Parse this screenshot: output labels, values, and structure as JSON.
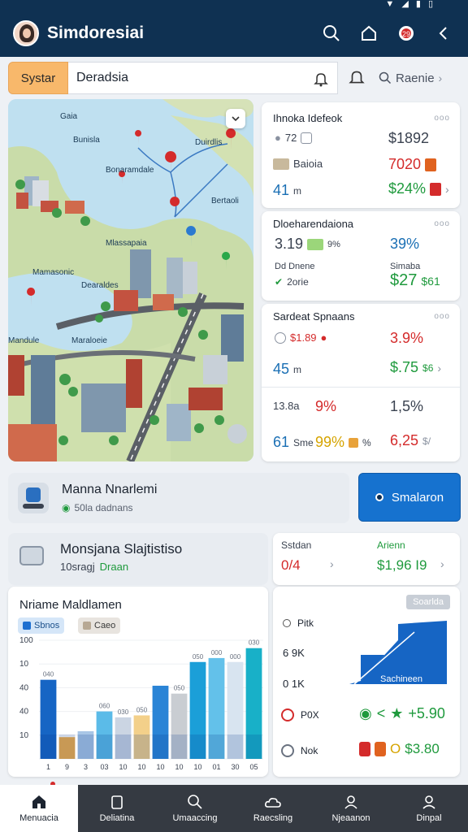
{
  "app": {
    "title": "Simdoresiai"
  },
  "header_icons": [
    "search-icon",
    "home-icon",
    "notification-badge-icon",
    "back-chevron-icon"
  ],
  "search": {
    "system_label": "Systar",
    "value": "Deradsia",
    "recent_label": "Raenie"
  },
  "map": {
    "labels": [
      "Gaia",
      "Bunisla",
      "Duirdlis",
      "Bonaramdale",
      "Bertaoli",
      "Mlassapaia",
      "Mamasonic",
      "Dearaldes",
      "Mandule",
      "Maraloeie"
    ]
  },
  "card1": {
    "title": "Ihnoka Idefeok",
    "row1": {
      "left": "72",
      "right": "$1892"
    },
    "row2": {
      "left": "Baioia",
      "right": "7020"
    },
    "row3": {
      "left": "41",
      "left_unit": "m",
      "right": "$24%"
    }
  },
  "card2": {
    "title": "Dloeharendaiona",
    "row1": {
      "left": "3.19",
      "left_unit": "9%",
      "right": "39%"
    },
    "row2": {
      "left": "Dd Dnene",
      "right": "Simaba"
    },
    "row3": {
      "left": "2orie",
      "right": "$27",
      "right_suffix": "$61"
    }
  },
  "card3": {
    "title": "Sardeat Spnaans",
    "row1": {
      "left": "$1.89",
      "right": "3.9%"
    },
    "row2": {
      "left": "45",
      "left_unit": "m",
      "right": "$.75",
      "right_suffix": "$6"
    },
    "row3": {
      "left": "13.8a",
      "mid": "9%",
      "right": "1,5%"
    },
    "row4": {
      "left": "61",
      "left_unit": "Sme",
      "mid": "99%",
      "mid_suffix": "%",
      "right": "6,25",
      "right_suffix": "$/"
    }
  },
  "manage": {
    "title": "Manna Nnarlemi",
    "subtitle": "50la dadnans"
  },
  "simulate_button": "Smalaron",
  "stats": {
    "title": "Monsjana Slajtistiso",
    "subtitle_prefix": "10sragj",
    "subtitle_accent": "Draan"
  },
  "side_stats": {
    "left_label": "Sstdan",
    "left_value": "0/4",
    "right_label": "Arienn",
    "right_value": "$1,96 I9"
  },
  "chart_card": {
    "title": "Nriame Maldlamen",
    "chips": [
      "Sbnos",
      "Caeo"
    ],
    "chart_data": {
      "type": "bar",
      "categories": [
        "1",
        "9",
        "3",
        "03",
        "10",
        "10",
        "10",
        "10",
        "10",
        "01",
        "30",
        "05"
      ],
      "series": [
        {
          "values": [
            200,
            55,
            70,
            120,
            105,
            110,
            185,
            165,
            245,
            255,
            245,
            280
          ],
          "color": "#1d6fd0"
        }
      ],
      "ytick_labels": [
        "",
        "10",
        "40",
        "40",
        "10",
        "100"
      ],
      "value_labels": [
        "040",
        "",
        "",
        "060",
        "030",
        "050",
        "",
        "050",
        "050",
        "000",
        "000",
        "030"
      ]
    }
  },
  "detail_card": {
    "badge": "Soarlda",
    "rows": [
      {
        "icon": "radio-icon",
        "label": "Pitk"
      },
      {
        "icon": "",
        "label": "6 9K"
      },
      {
        "icon": "",
        "label": "0 1K"
      },
      {
        "icon": "rate-icon",
        "label": "P0X",
        "value": "+5.90"
      },
      {
        "icon": "settings-icon",
        "label": "Nok",
        "value": "$3.80"
      }
    ],
    "graph_label": "Sachineen"
  },
  "nav": {
    "items": [
      {
        "label": "Menuacia",
        "icon": "home-icon"
      },
      {
        "label": "Deliatina",
        "icon": "clipboard-icon"
      },
      {
        "label": "Umaaccing",
        "icon": "search-icon"
      },
      {
        "label": "Raecsling",
        "icon": "cloud-icon"
      },
      {
        "label": "Njeaanon",
        "icon": "user-icon"
      },
      {
        "label": "Dinpal",
        "icon": "profile-icon"
      }
    ]
  }
}
